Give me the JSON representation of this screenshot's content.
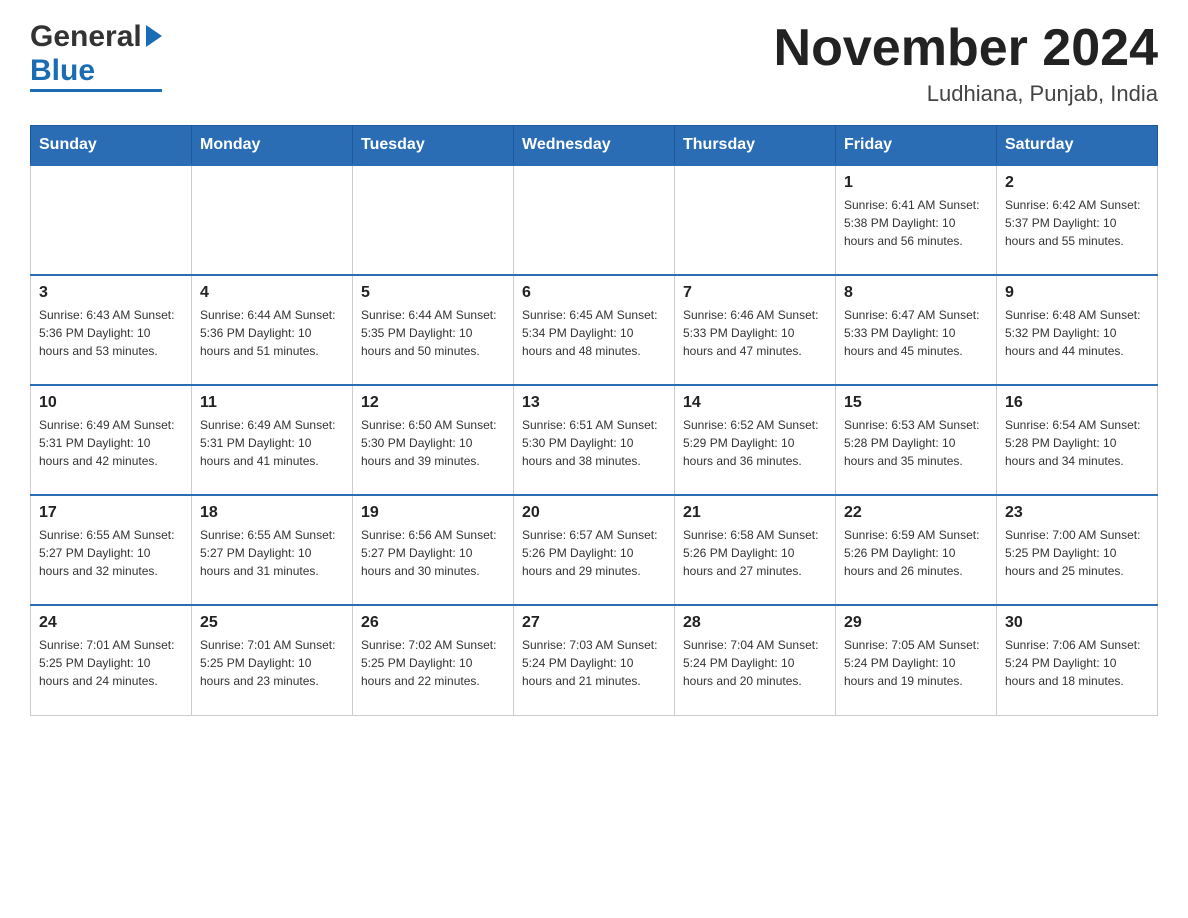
{
  "header": {
    "title": "November 2024",
    "subtitle": "Ludhiana, Punjab, India",
    "logo_general": "General",
    "logo_blue": "Blue"
  },
  "days_of_week": [
    "Sunday",
    "Monday",
    "Tuesday",
    "Wednesday",
    "Thursday",
    "Friday",
    "Saturday"
  ],
  "weeks": [
    [
      {
        "day": "",
        "info": ""
      },
      {
        "day": "",
        "info": ""
      },
      {
        "day": "",
        "info": ""
      },
      {
        "day": "",
        "info": ""
      },
      {
        "day": "",
        "info": ""
      },
      {
        "day": "1",
        "info": "Sunrise: 6:41 AM\nSunset: 5:38 PM\nDaylight: 10 hours and 56 minutes."
      },
      {
        "day": "2",
        "info": "Sunrise: 6:42 AM\nSunset: 5:37 PM\nDaylight: 10 hours and 55 minutes."
      }
    ],
    [
      {
        "day": "3",
        "info": "Sunrise: 6:43 AM\nSunset: 5:36 PM\nDaylight: 10 hours and 53 minutes."
      },
      {
        "day": "4",
        "info": "Sunrise: 6:44 AM\nSunset: 5:36 PM\nDaylight: 10 hours and 51 minutes."
      },
      {
        "day": "5",
        "info": "Sunrise: 6:44 AM\nSunset: 5:35 PM\nDaylight: 10 hours and 50 minutes."
      },
      {
        "day": "6",
        "info": "Sunrise: 6:45 AM\nSunset: 5:34 PM\nDaylight: 10 hours and 48 minutes."
      },
      {
        "day": "7",
        "info": "Sunrise: 6:46 AM\nSunset: 5:33 PM\nDaylight: 10 hours and 47 minutes."
      },
      {
        "day": "8",
        "info": "Sunrise: 6:47 AM\nSunset: 5:33 PM\nDaylight: 10 hours and 45 minutes."
      },
      {
        "day": "9",
        "info": "Sunrise: 6:48 AM\nSunset: 5:32 PM\nDaylight: 10 hours and 44 minutes."
      }
    ],
    [
      {
        "day": "10",
        "info": "Sunrise: 6:49 AM\nSunset: 5:31 PM\nDaylight: 10 hours and 42 minutes."
      },
      {
        "day": "11",
        "info": "Sunrise: 6:49 AM\nSunset: 5:31 PM\nDaylight: 10 hours and 41 minutes."
      },
      {
        "day": "12",
        "info": "Sunrise: 6:50 AM\nSunset: 5:30 PM\nDaylight: 10 hours and 39 minutes."
      },
      {
        "day": "13",
        "info": "Sunrise: 6:51 AM\nSunset: 5:30 PM\nDaylight: 10 hours and 38 minutes."
      },
      {
        "day": "14",
        "info": "Sunrise: 6:52 AM\nSunset: 5:29 PM\nDaylight: 10 hours and 36 minutes."
      },
      {
        "day": "15",
        "info": "Sunrise: 6:53 AM\nSunset: 5:28 PM\nDaylight: 10 hours and 35 minutes."
      },
      {
        "day": "16",
        "info": "Sunrise: 6:54 AM\nSunset: 5:28 PM\nDaylight: 10 hours and 34 minutes."
      }
    ],
    [
      {
        "day": "17",
        "info": "Sunrise: 6:55 AM\nSunset: 5:27 PM\nDaylight: 10 hours and 32 minutes."
      },
      {
        "day": "18",
        "info": "Sunrise: 6:55 AM\nSunset: 5:27 PM\nDaylight: 10 hours and 31 minutes."
      },
      {
        "day": "19",
        "info": "Sunrise: 6:56 AM\nSunset: 5:27 PM\nDaylight: 10 hours and 30 minutes."
      },
      {
        "day": "20",
        "info": "Sunrise: 6:57 AM\nSunset: 5:26 PM\nDaylight: 10 hours and 29 minutes."
      },
      {
        "day": "21",
        "info": "Sunrise: 6:58 AM\nSunset: 5:26 PM\nDaylight: 10 hours and 27 minutes."
      },
      {
        "day": "22",
        "info": "Sunrise: 6:59 AM\nSunset: 5:26 PM\nDaylight: 10 hours and 26 minutes."
      },
      {
        "day": "23",
        "info": "Sunrise: 7:00 AM\nSunset: 5:25 PM\nDaylight: 10 hours and 25 minutes."
      }
    ],
    [
      {
        "day": "24",
        "info": "Sunrise: 7:01 AM\nSunset: 5:25 PM\nDaylight: 10 hours and 24 minutes."
      },
      {
        "day": "25",
        "info": "Sunrise: 7:01 AM\nSunset: 5:25 PM\nDaylight: 10 hours and 23 minutes."
      },
      {
        "day": "26",
        "info": "Sunrise: 7:02 AM\nSunset: 5:25 PM\nDaylight: 10 hours and 22 minutes."
      },
      {
        "day": "27",
        "info": "Sunrise: 7:03 AM\nSunset: 5:24 PM\nDaylight: 10 hours and 21 minutes."
      },
      {
        "day": "28",
        "info": "Sunrise: 7:04 AM\nSunset: 5:24 PM\nDaylight: 10 hours and 20 minutes."
      },
      {
        "day": "29",
        "info": "Sunrise: 7:05 AM\nSunset: 5:24 PM\nDaylight: 10 hours and 19 minutes."
      },
      {
        "day": "30",
        "info": "Sunrise: 7:06 AM\nSunset: 5:24 PM\nDaylight: 10 hours and 18 minutes."
      }
    ]
  ]
}
